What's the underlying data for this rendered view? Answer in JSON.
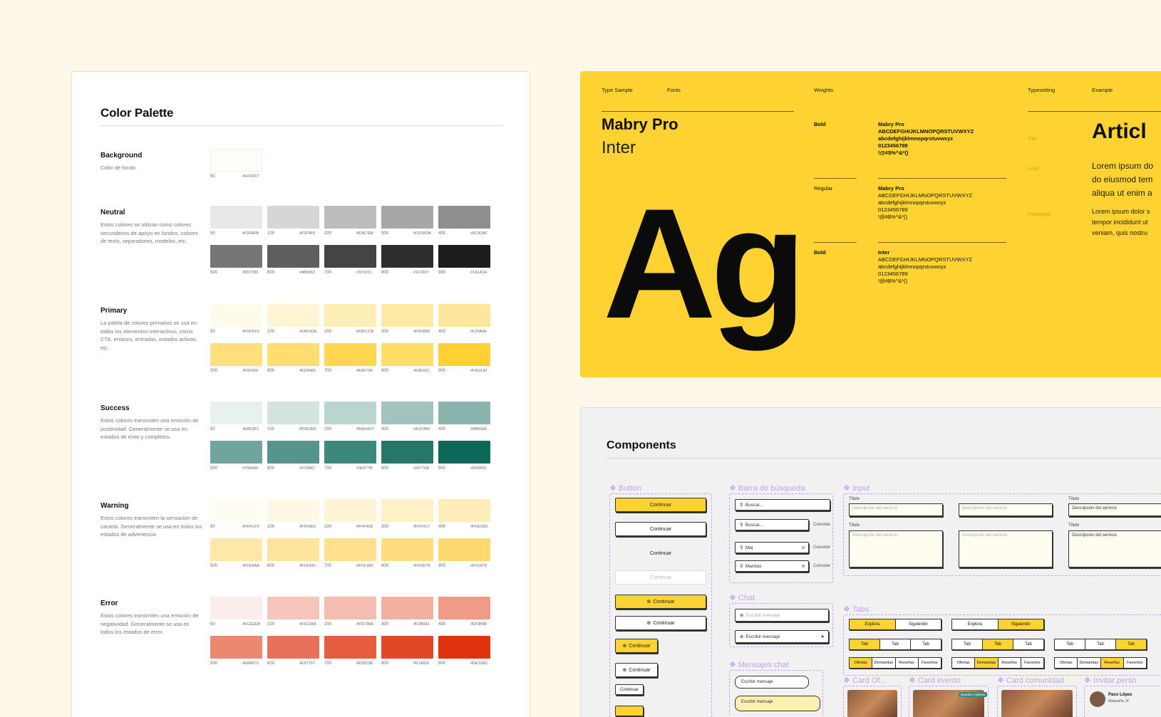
{
  "palette": {
    "title": "Color Palette",
    "groups": [
      {
        "name": "Background",
        "desc": "Color de fondo.",
        "rows": [
          [
            {
              "n": "50",
              "hex": "#FFFDF7"
            }
          ]
        ]
      },
      {
        "name": "Neutral",
        "desc": "Estos colores se utilizan como colores secundarios de apoyo en fondos, colores de texto, separadores, modelos, etc.",
        "rows": [
          [
            {
              "n": "50",
              "hex": "#F9FAFB"
            },
            {
              "n": "100",
              "hex": "#F3F4F6"
            },
            {
              "n": "200",
              "hex": "#E5E7EB"
            },
            {
              "n": "300",
              "hex": "#D1D5DB"
            },
            {
              "n": "400",
              "hex": "#9CA3AF"
            }
          ],
          [
            {
              "n": "500",
              "hex": "#6B7280"
            },
            {
              "n": "600",
              "hex": "#4B5563"
            },
            {
              "n": "700",
              "hex": "#374151"
            },
            {
              "n": "800",
              "hex": "#1F2937"
            },
            {
              "n": "900",
              "hex": "#1A1A1A"
            }
          ]
        ]
      },
      {
        "name": "Primary",
        "desc": "La paleta de colores primarios se usa en todos los elementos interactivos, como CTA, enlaces, entradas, estados activos, etc.",
        "rows": [
          [
            {
              "n": "50",
              "hex": "#FDFEF0"
            },
            {
              "n": "100",
              "hex": "#FAFDDE"
            },
            {
              "n": "200",
              "hex": "#F8FCCB"
            },
            {
              "n": "300",
              "hex": "#F5FBB9"
            },
            {
              "n": "400",
              "hex": "#F2FAA6"
            }
          ],
          [
            {
              "n": "500",
              "hex": "#F0F994"
            },
            {
              "n": "600",
              "hex": "#EDF881"
            },
            {
              "n": "700",
              "hex": "#EAF76F"
            },
            {
              "n": "800",
              "hex": "#E8F65C"
            },
            {
              "n": "900",
              "hex": "#FED132"
            }
          ]
        ]
      },
      {
        "name": "Success",
        "desc": "Estos colores transmiten una emoción de positividad. Generalmente se usa en estados de éxito y completos.",
        "rows": [
          [
            {
              "n": "50",
              "hex": "#EBF3F1"
            },
            {
              "n": "100",
              "hex": "#D2E3E0"
            },
            {
              "n": "200",
              "hex": "#BAD4CF"
            },
            {
              "n": "300",
              "hex": "#A1C4BF"
            },
            {
              "n": "400",
              "hex": "#88B5AE"
            }
          ],
          [
            {
              "n": "500",
              "hex": "#70A690"
            },
            {
              "n": "600",
              "hex": "#57968C"
            },
            {
              "n": "700",
              "hex": "#3E877B"
            },
            {
              "n": "800",
              "hex": "#26776A"
            },
            {
              "n": "900",
              "hex": "#0D6859"
            }
          ]
        ]
      },
      {
        "name": "Warning",
        "desc": "Estos colores transmiten la sensación de cautela. Generalmente se usa en todos los estados de advertencia.",
        "rows": [
          [
            {
              "n": "50",
              "hex": "#FFFCF3"
            },
            {
              "n": "100",
              "hex": "#FFF8E5"
            },
            {
              "n": "200",
              "hex": "#FFF4D6"
            },
            {
              "n": "300",
              "hex": "#FFF0C7"
            },
            {
              "n": "400",
              "hex": "#FFECB9"
            }
          ],
          [
            {
              "n": "500",
              "hex": "#FFE8AA"
            },
            {
              "n": "600",
              "hex": "#FFE59C"
            },
            {
              "n": "700",
              "hex": "#FFE18D"
            },
            {
              "n": "800",
              "hex": "#FFDD7F"
            },
            {
              "n": "900",
              "hex": "#FFD970"
            }
          ]
        ]
      },
      {
        "name": "Error",
        "desc": "Estos colores transmiten una emoción de negatividad. Generalmente se usa en todos los estados de error.",
        "rows": [
          [
            {
              "n": "50",
              "hex": "#FCEEEB"
            },
            {
              "n": "100",
              "hex": "#F6C5BA"
            },
            {
              "n": "200",
              "hex": "#F6C5BA"
            },
            {
              "n": "300",
              "hex": "#F2B0A1"
            },
            {
              "n": "400",
              "hex": "#EF9B88"
            }
          ],
          [
            {
              "n": "500",
              "hex": "#EB8870"
            },
            {
              "n": "600",
              "hex": "#E67157"
            },
            {
              "n": "700",
              "hex": "#E55D3E"
            },
            {
              "n": "800",
              "hex": "#E14826"
            },
            {
              "n": "900",
              "hex": "#DE330D"
            }
          ]
        ]
      }
    ],
    "swatch_fills": {
      "Background": [
        "#FFFDF7"
      ],
      "Neutral": [
        "#E8E8E8",
        "#D6D6D6",
        "#BCBCBC",
        "#A7A7A7",
        "#8E8E8E",
        "#767676",
        "#5E5E5E",
        "#444444",
        "#2E2E2E",
        "#1C1C1C"
      ],
      "Primary": [
        "#FFFBEA",
        "#FFF5D3",
        "#FFEFB6",
        "#FFEAA5",
        "#FFE69A",
        "#FFDF7A",
        "#FFDD6E",
        "#FED650",
        "#FFDE66",
        "#FED132"
      ],
      "Success": [
        "#E8F1EE",
        "#D3E4E0",
        "#B9D5CF",
        "#A1C5BE",
        "#88B5AE",
        "#6FA59D",
        "#56958B",
        "#3E877B",
        "#26776A",
        "#0D6859"
      ],
      "Warning": [
        "#FFFCF3",
        "#FFF8E5",
        "#FFF4D6",
        "#FFF0C7",
        "#FFECB9",
        "#FFE8AA",
        "#FFE59C",
        "#FFE18D",
        "#FFDD7F",
        "#FFD970"
      ],
      "Error": [
        "#FBEDEA",
        "#F6C5BA",
        "#F3BDB0",
        "#F2B0A1",
        "#EF9B88",
        "#EB8870",
        "#E87259",
        "#E55D3E",
        "#E14826",
        "#DE330D"
      ]
    }
  },
  "type": {
    "headers": {
      "sample": "Type Sample",
      "fonts": "Fonts",
      "weights": "Weights",
      "typesetting": "Typesetting",
      "example": "Example"
    },
    "font1": "Mabry Pro",
    "font2": "Inter",
    "big": "Ag",
    "weights": [
      {
        "label": "Bold",
        "font": "Mabry Pro",
        "lines": [
          "ABCDEFGHIJKLMNOPQRSTUVWXYZ",
          "abcdefghijklmnopqrstuvwxyz",
          "0123456789",
          "!@#$%^&*()"
        ]
      },
      {
        "label": "Regular",
        "font": "Mabry Pro",
        "lines": [
          "ABCDEFGHIJKLMNOPQRSTUVWXYZ",
          "abcdefghijklmnopqrstuvwxyz",
          "0123456789",
          "!@#$%^&*()"
        ]
      },
      {
        "label": "Bold",
        "font": "Inter",
        "lines": [
          "ABCDEFGHIJKLMNOPQRSTUVWXYZ",
          "abcdefghijklmnopqrstuvwxyz",
          "0123456789",
          "!@#$%^&*()"
        ]
      }
    ],
    "typesetting": {
      "title": "Title",
      "lead": "Lead",
      "paragraph": "Paragraph"
    },
    "example": {
      "title": "Articl",
      "lead": [
        "Lorem ipsum do",
        "do eiusmod tem",
        "aliqua ut enim a"
      ],
      "para": [
        "Lorem ipsum dolor s",
        "tempor incididunt ut",
        "veniam, quis nostru"
      ]
    }
  },
  "components": {
    "title": "Components",
    "sections": {
      "button": "❖ Button",
      "search": "❖ Barra de búsqueda",
      "input": "❖ Input",
      "chat": "❖ Chat",
      "tabs": "❖ Tabs",
      "chat_msgs": "❖ Mensajes chat",
      "card_of": "❖ Card Of...",
      "card_evento": "❖ Card evento",
      "card_comunidad": "❖ Card comunidad",
      "invitar": "❖ Invitar perso"
    },
    "button_label": "Continuar",
    "search": {
      "ph": "Buscar...",
      "typing": "Buscar...",
      "q1": "Ma|",
      "q2": "Manitas",
      "cancel": "Cancelar"
    },
    "input": {
      "label": "Título",
      "ph": "Descripción del servicio"
    },
    "chat": {
      "ph": "Escribir mensaje",
      "typing": "Escribir mensaje"
    },
    "tabs": {
      "row1": [
        "Explora",
        "Siguiendo"
      ],
      "row2": [
        "Tab",
        "Tab",
        "Tab"
      ],
      "row3": [
        "Ofertas",
        "Demandas",
        "Reseñas",
        "Favoritos"
      ]
    },
    "chat_msgs": {
      "m1": "Escribir mensaje",
      "m2": "Escribir mensaje"
    },
    "invite": {
      "name": "Paco López",
      "loc": "Malasaña, M"
    },
    "event_badge": "Quedan 3 plazas"
  }
}
